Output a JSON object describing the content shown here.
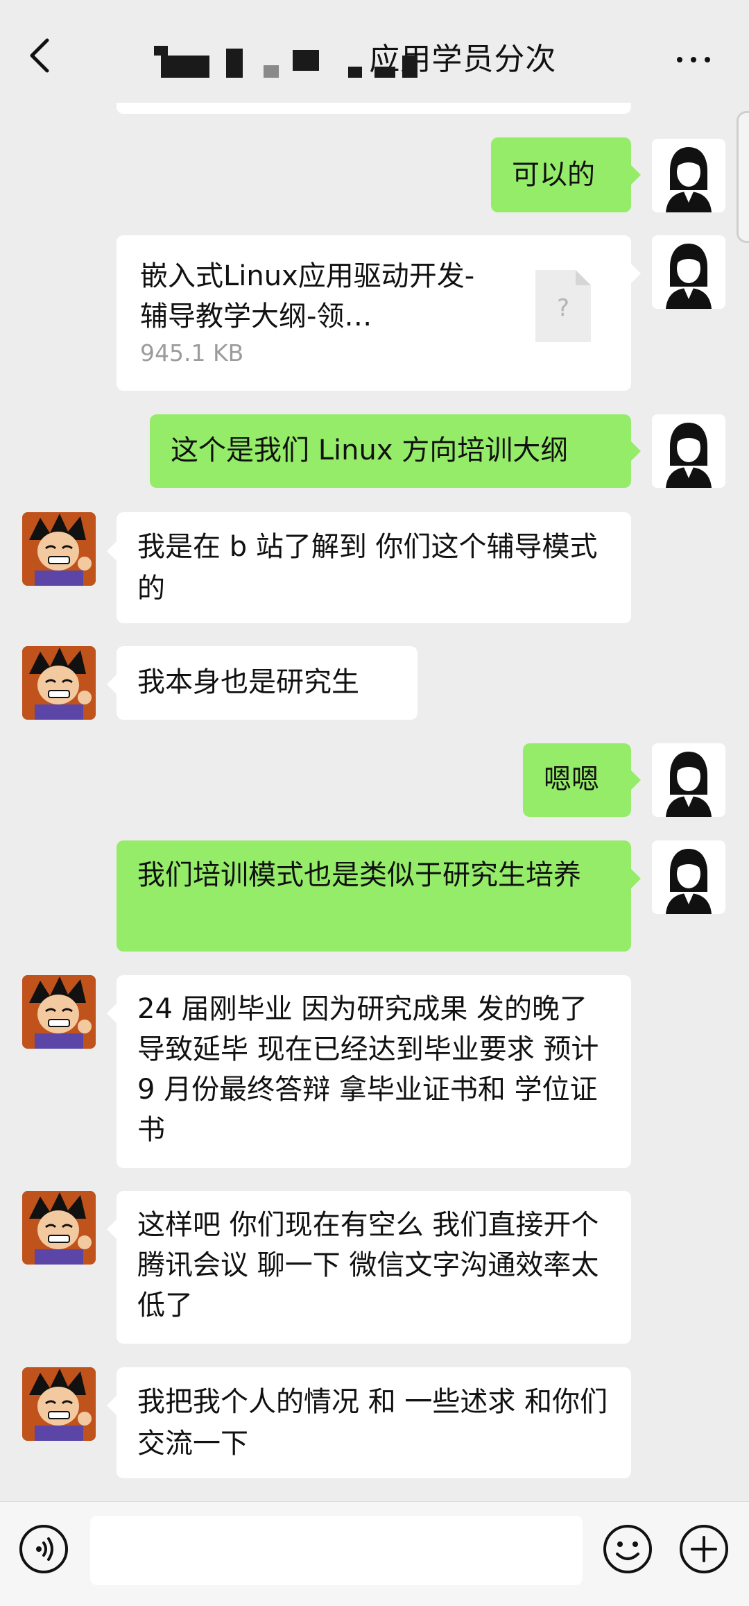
{
  "header": {
    "title": "                 应用学员分次",
    "back_icon": "chevron-left-icon",
    "more_icon": "ellipsis-icon"
  },
  "messages": [
    {
      "side": "out",
      "type": "text",
      "text": "可以的"
    },
    {
      "side": "out",
      "type": "file",
      "file_name": "嵌入式Linux应用驱动开发-辅导教学大纲-领…",
      "file_size": "945.1 KB",
      "icon": "unknown-file-icon"
    },
    {
      "side": "out",
      "type": "text",
      "text": "这个是我们 Linux 方向培训大纲"
    },
    {
      "side": "in",
      "type": "text",
      "text": "我是在 b 站了解到 你们这个辅导模式的"
    },
    {
      "side": "in",
      "type": "text",
      "text": "我本身也是研究生"
    },
    {
      "side": "out",
      "type": "text",
      "text": "嗯嗯"
    },
    {
      "side": "out",
      "type": "text",
      "text": "我们培训模式也是类似于研究生培养"
    },
    {
      "side": "in",
      "type": "text",
      "text": "24 届刚毕业  因为研究成果 发的晚了 导致延毕  现在已经达到毕业要求 预计 9 月份最终答辩 拿毕业证书和 学位证书"
    },
    {
      "side": "in",
      "type": "text",
      "text": "这样吧 你们现在有空么 我们直接开个腾讯会议 聊一下 微信文字沟通效率太低了"
    },
    {
      "side": "in",
      "type": "text",
      "text": "我把我个人的情况 和 一些述求 和你们交流一下"
    }
  ],
  "input": {
    "value": "",
    "placeholder": "",
    "voice_icon": "voice-icon",
    "emoji_icon": "emoji-icon",
    "plus_icon": "plus-icon"
  },
  "colors": {
    "background": "#ededed",
    "outgoing_bubble": "#95ec69",
    "incoming_bubble": "#ffffff"
  }
}
